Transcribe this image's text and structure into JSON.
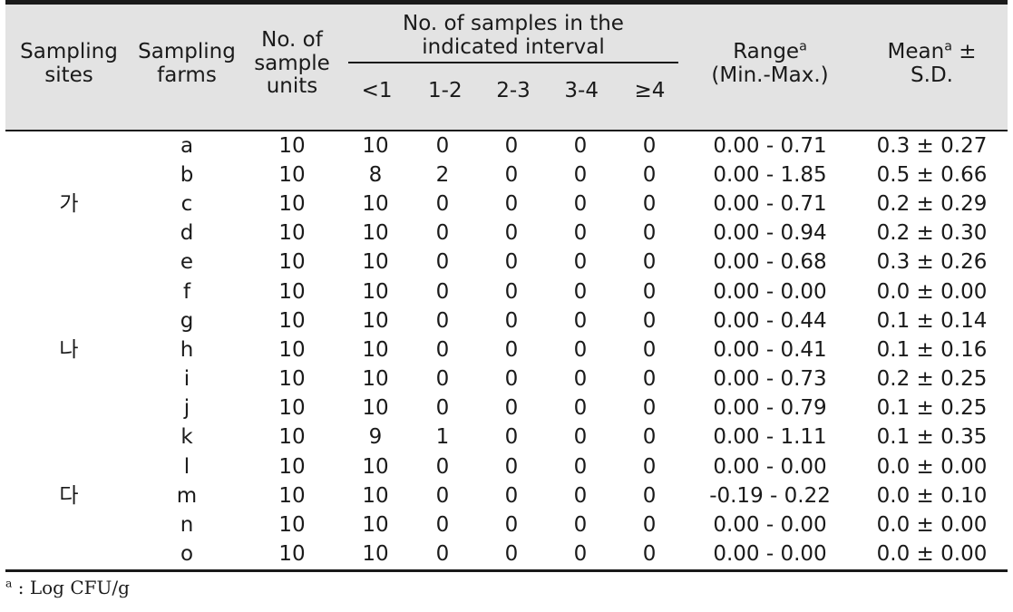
{
  "table": {
    "header": {
      "col_site_line1": "Sampling",
      "col_site_line2": "sites",
      "col_farm_line1": "Sampling",
      "col_farm_line2": "farms",
      "col_units_line1": "No. of",
      "col_units_line2": "sample",
      "col_units_line3": "units",
      "group_title_line1": "No. of samples in the",
      "group_title_line2": "indicated interval",
      "intervals": [
        "<1",
        "1-2",
        "2-3",
        "3-4",
        "≥4"
      ],
      "col_range_line1": "Range",
      "col_range_note": "a",
      "col_range_line2": "(Min.-Max.)",
      "col_mean_line1": "Mean",
      "col_mean_note": "a",
      "col_mean_pm": "±",
      "col_mean_line2": "S.D."
    },
    "rows": [
      {
        "site": "",
        "farm": "a",
        "units": "10",
        "i1": "10",
        "i2": "0",
        "i3": "0",
        "i4": "0",
        "i5": "0",
        "range": "0.00 - 0.71",
        "mean": "0.3 ± 0.27"
      },
      {
        "site": "",
        "farm": "b",
        "units": "10",
        "i1": "8",
        "i2": "2",
        "i3": "0",
        "i4": "0",
        "i5": "0",
        "range": "0.00 - 1.85",
        "mean": "0.5 ± 0.66"
      },
      {
        "site": "가",
        "farm": "c",
        "units": "10",
        "i1": "10",
        "i2": "0",
        "i3": "0",
        "i4": "0",
        "i5": "0",
        "range": "0.00 - 0.71",
        "mean": "0.2 ± 0.29"
      },
      {
        "site": "",
        "farm": "d",
        "units": "10",
        "i1": "10",
        "i2": "0",
        "i3": "0",
        "i4": "0",
        "i5": "0",
        "range": "0.00 - 0.94",
        "mean": "0.2 ± 0.30"
      },
      {
        "site": "",
        "farm": "e",
        "units": "10",
        "i1": "10",
        "i2": "0",
        "i3": "0",
        "i4": "0",
        "i5": "0",
        "range": "0.00 - 0.68",
        "mean": "0.3 ± 0.26"
      },
      {
        "site": "",
        "farm": "f",
        "units": "10",
        "i1": "10",
        "i2": "0",
        "i3": "0",
        "i4": "0",
        "i5": "0",
        "range": "0.00 - 0.00",
        "mean": "0.0 ± 0.00"
      },
      {
        "site": "",
        "farm": "g",
        "units": "10",
        "i1": "10",
        "i2": "0",
        "i3": "0",
        "i4": "0",
        "i5": "0",
        "range": "0.00 - 0.44",
        "mean": "0.1 ± 0.14"
      },
      {
        "site": "나",
        "farm": "h",
        "units": "10",
        "i1": "10",
        "i2": "0",
        "i3": "0",
        "i4": "0",
        "i5": "0",
        "range": "0.00 - 0.41",
        "mean": "0.1 ± 0.16"
      },
      {
        "site": "",
        "farm": "i",
        "units": "10",
        "i1": "10",
        "i2": "0",
        "i3": "0",
        "i4": "0",
        "i5": "0",
        "range": "0.00 - 0.73",
        "mean": "0.2 ± 0.25"
      },
      {
        "site": "",
        "farm": "j",
        "units": "10",
        "i1": "10",
        "i2": "0",
        "i3": "0",
        "i4": "0",
        "i5": "0",
        "range": "0.00 - 0.79",
        "mean": "0.1 ± 0.25"
      },
      {
        "site": "",
        "farm": "k",
        "units": "10",
        "i1": "9",
        "i2": "1",
        "i3": "0",
        "i4": "0",
        "i5": "0",
        "range": "0.00 - 1.11",
        "mean": "0.1 ± 0.35"
      },
      {
        "site": "",
        "farm": "l",
        "units": "10",
        "i1": "10",
        "i2": "0",
        "i3": "0",
        "i4": "0",
        "i5": "0",
        "range": "0.00 - 0.00",
        "mean": "0.0 ± 0.00"
      },
      {
        "site": "다",
        "farm": "m",
        "units": "10",
        "i1": "10",
        "i2": "0",
        "i3": "0",
        "i4": "0",
        "i5": "0",
        "range": "-0.19 - 0.22",
        "mean": "0.0 ± 0.10"
      },
      {
        "site": "",
        "farm": "n",
        "units": "10",
        "i1": "10",
        "i2": "0",
        "i3": "0",
        "i4": "0",
        "i5": "0",
        "range": "0.00 - 0.00",
        "mean": "0.0 ± 0.00"
      },
      {
        "site": "",
        "farm": "o",
        "units": "10",
        "i1": "10",
        "i2": "0",
        "i3": "0",
        "i4": "0",
        "i5": "0",
        "range": "0.00 - 0.00",
        "mean": "0.0 ± 0.00"
      }
    ],
    "footnote": {
      "marker": "a",
      "text": " :  Log  CFU/g"
    }
  },
  "colors": {
    "header_background": "#e3e3e3",
    "rule": "#1a1a1a",
    "text": "#1a1a1a",
    "page_background": "#ffffff"
  }
}
